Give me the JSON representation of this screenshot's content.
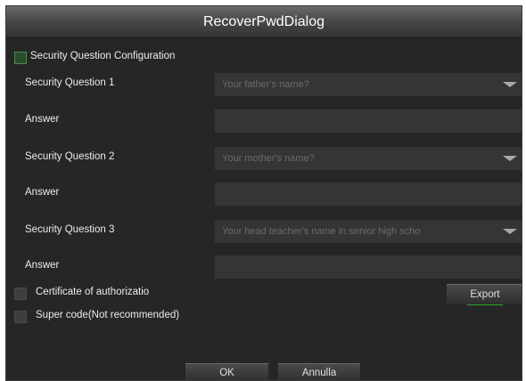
{
  "dialog": {
    "title": "RecoverPwdDialog"
  },
  "security_config": {
    "label": "Security Question Configuration",
    "checked": true
  },
  "questions": [
    {
      "label": "Security Question 1",
      "value": "Your father's name?",
      "answer_label": "Answer",
      "answer_value": ""
    },
    {
      "label": "Security Question 2",
      "value": "Your mother's name?",
      "answer_label": "Answer",
      "answer_value": ""
    },
    {
      "label": "Security Question 3",
      "value": "Your head teacher's name in senior high scho",
      "answer_label": "Answer",
      "answer_value": ""
    }
  ],
  "certificate": {
    "label": "Certificate of authorizatio",
    "checked": false
  },
  "export_button": {
    "label": "Export"
  },
  "super_code": {
    "label": "Super code(Not recommended)",
    "checked": false
  },
  "footer": {
    "ok_label": "OK",
    "cancel_label": "Annulla"
  },
  "colors": {
    "dialog_bg": "#262626",
    "field_bg": "#353535",
    "accent_green": "#2aa22a"
  },
  "icons": {
    "dropdown": "triangle-down-icon"
  }
}
